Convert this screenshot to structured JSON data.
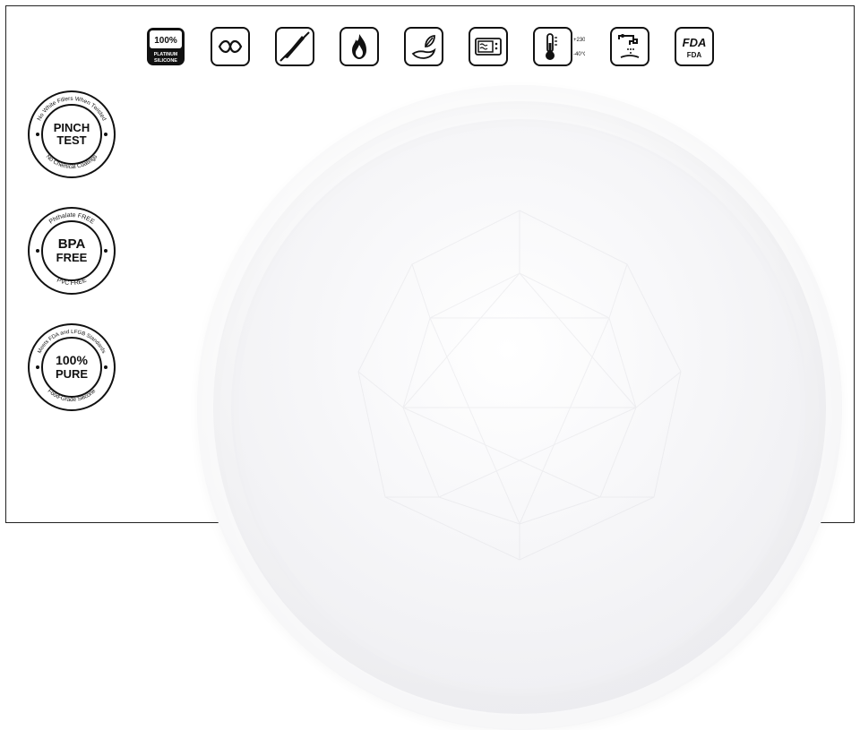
{
  "iconRow": [
    {
      "name": "platinum-silicone-icon",
      "label1": "100%",
      "label2": "PLATINUM",
      "label3": "SILICONE"
    },
    {
      "name": "flexible-icon"
    },
    {
      "name": "no-knife-icon"
    },
    {
      "name": "flame-safe-icon"
    },
    {
      "name": "food-safe-hand-icon"
    },
    {
      "name": "microwave-safe-icon"
    },
    {
      "name": "temperature-range-icon",
      "high": "+230°C",
      "low": "-40°C"
    },
    {
      "name": "dishwasher-safe-icon"
    },
    {
      "name": "fda-icon",
      "label1": "FDA",
      "label2": "FDA"
    }
  ],
  "badges": [
    {
      "name": "pinch-test-badge",
      "main1": "PINCH",
      "main2": "TEST",
      "ringTop": "No White Fillers When Twisted",
      "ringBottom": "No Chemical Coatings"
    },
    {
      "name": "bpa-free-badge",
      "main1": "BPA",
      "main2": "FREE",
      "ringTop": "Phthalate FREE",
      "ringBottom": "PVC FREE"
    },
    {
      "name": "pure-badge",
      "main1": "100%",
      "main2": "PURE",
      "ringTop": "Meets FDA and LFGB Standards",
      "ringBottom": "Food-Grade Silicone"
    }
  ],
  "product": {
    "name": "silicone-mold-dome"
  }
}
